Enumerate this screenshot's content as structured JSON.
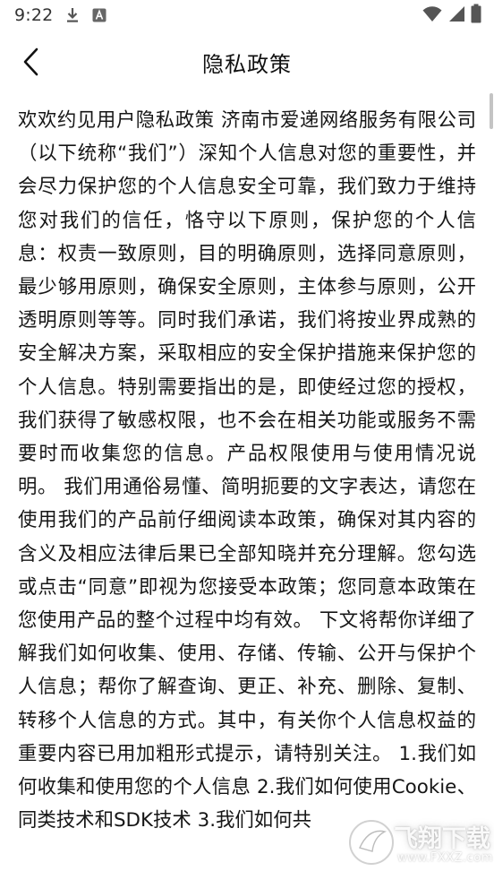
{
  "status_bar": {
    "time": "9:22",
    "icons": [
      "download-icon",
      "font-icon",
      "wifi-icon",
      "signal-icon",
      "battery-icon"
    ]
  },
  "header": {
    "back_icon": "chevron-left-icon",
    "title": "隐私政策"
  },
  "content": {
    "body": "欢欢约见用户隐私政策 济南市爱递网络服务有限公司（以下统称“我们”）深知个人信息对您的重要性，并会尽力保护您的个人信息安全可靠，我们致力于维持您对我们的信任，恪守以下原则，保护您的个人信息：权责一致原则，目的明确原则，选择同意原则，最少够用原则，确保安全原则，主体参与原则，公开透明原则等等。同时我们承诺，我们将按业界成熟的安全解决方案，采取相应的安全保护措施来保护您的个人信息。特别需要指出的是，即使经过您的授权，我们获得了敏感权限，也不会在相关功能或服务不需要时而收集您的信息。产品权限使用与使用情况说明。 我们用通俗易懂、简明扼要的文字表达，请您在使用我们的产品前仔细阅读本政策，确保对其内容的含义及相应法律后果已全部知晓并充分理解。您勾选或点击“同意”即视为您接受本政策；您同意本政策在您使用产品的整个过程中均有效。 下文将帮你详细了解我们如何收集、使用、存储、传输、公开与保护个人信息；帮你了解查询、更正、补充、删除、复制、转移个人信息的方式。其中，有关你个人信息权益的重要内容已用加粗形式提示，请特别关注。 1.我们如何收集和使用您的个人信息 2.我们如何使用Cookie、同类技术和SDK技术 3.我们如何共"
  },
  "watermark": {
    "main": "飞翔下载",
    "sub": "www.FXXZ.com"
  }
}
